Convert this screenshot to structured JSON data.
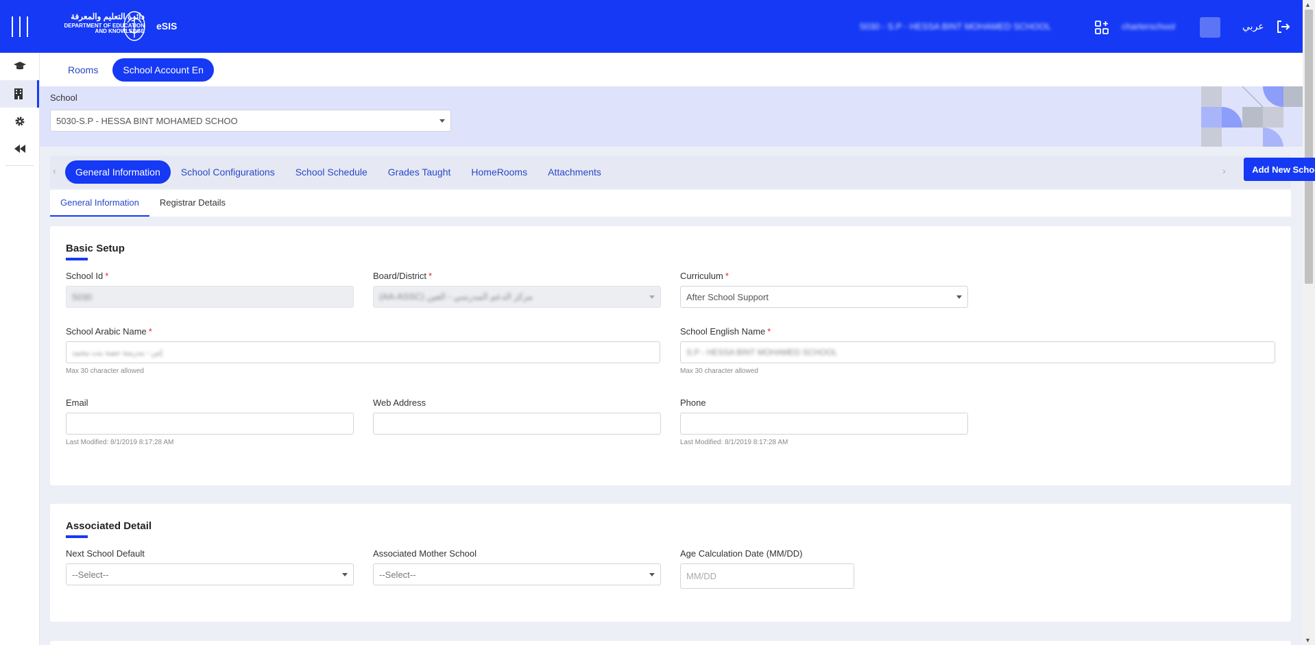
{
  "app": {
    "logo_ar": "دائرة التعليم والمعرفة",
    "logo_en1": "DEPARTMENT OF EDUCATION",
    "logo_en2": "AND KNOWLEDGE",
    "name": "eSIS",
    "school_context": "5030 - S.P - HESSA BINT MOHAMED SCHOOL",
    "user": "charterschool",
    "language": "عربي"
  },
  "colors": {
    "primary": "#1539f5",
    "danger": "#e02424"
  },
  "icons": {
    "menu": "menu-icon",
    "graduation": "graduation-cap-icon",
    "building": "building-icon",
    "settings": "gear-icon",
    "collapse": "double-left-icon",
    "apps": "apps-add-icon",
    "logout": "logout-icon"
  },
  "top_tabs": [
    "Rooms",
    "School Account En"
  ],
  "school": {
    "label": "School",
    "value": "5030-S.P - HESSA BINT MOHAMED SCHOO"
  },
  "section_tabs": [
    "General Information",
    "School Configurations",
    "School Schedule",
    "Grades Taught",
    "HomeRooms",
    "Attachments"
  ],
  "add_button": "Add New School",
  "sub_tabs": [
    "General Information",
    "Registrar Details"
  ],
  "basic": {
    "title": "Basic Setup",
    "school_id": {
      "label": "School Id",
      "value": "5030"
    },
    "board": {
      "label": "Board/District",
      "value": "(AA-ASSC) مركز الدعم المدرسي - العين"
    },
    "curriculum": {
      "label": "Curriculum",
      "value": "After School Support"
    },
    "arabic_name": {
      "label": "School Arabic Name",
      "value": "إس - مدرسة حصة بنت محمد",
      "hint": "Max 30 character allowed"
    },
    "english_name": {
      "label": "School English Name",
      "value": "S.P - HESSA BINT MOHAMED SCHOOL",
      "hint": "Max 30 character allowed"
    },
    "email": {
      "label": "Email",
      "value": ""
    },
    "web": {
      "label": "Web Address",
      "value": ""
    },
    "phone": {
      "label": "Phone",
      "value": ""
    },
    "email_modified": "Last Modified:  8/1/2019 8:17:28 AM",
    "phone_modified": "Last Modified:  8/1/2019 8:17:28 AM"
  },
  "associated": {
    "title": "Associated Detail",
    "next_school": {
      "label": "Next School Default",
      "value": "--Select--"
    },
    "mother_school": {
      "label": "Associated Mother School",
      "value": "--Select--"
    },
    "age_date": {
      "label": "Age Calculation Date (MM/DD)",
      "placeholder": "MM/DD"
    }
  }
}
